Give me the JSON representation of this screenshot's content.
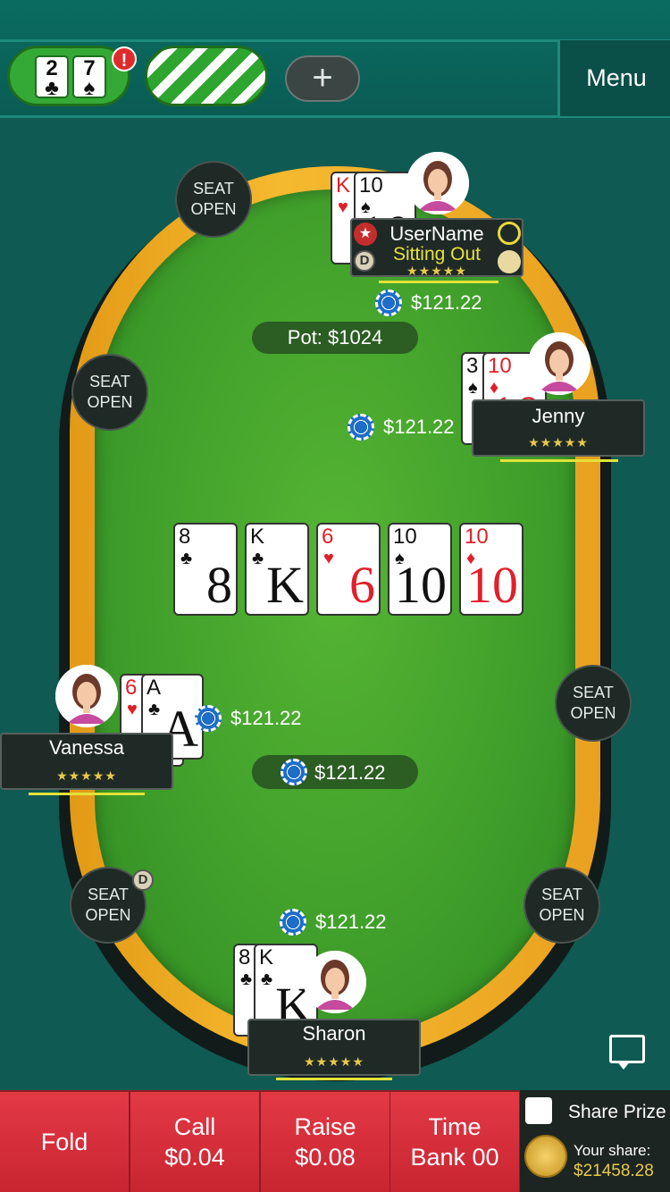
{
  "topbar": {
    "tab1_cards": [
      {
        "rank": "2",
        "suit": "♣"
      },
      {
        "rank": "7",
        "suit": "♠"
      }
    ],
    "notification_badge": "!",
    "add_label": "+",
    "menu_label": "Menu"
  },
  "table": {
    "pot_label": "Pot: $1024",
    "center_bet": "$121.22",
    "community_cards": [
      {
        "rank": "8",
        "suit": "♣",
        "color": "#111111"
      },
      {
        "rank": "K",
        "suit": "♣",
        "color": "#111111"
      },
      {
        "rank": "6",
        "suit": "♥",
        "color": "#e0202a"
      },
      {
        "rank": "10",
        "suit": "♠",
        "color": "#111111"
      },
      {
        "rank": "10",
        "suit": "♦",
        "color": "#e0202a"
      }
    ],
    "seat_open_line1": "SEAT",
    "seat_open_line2": "OPEN",
    "dealer_label": "D"
  },
  "players": {
    "username": {
      "name": "UserName",
      "status": "Sitting Out",
      "stars": "★★★★★",
      "bet": "$121.22",
      "cards": [
        {
          "rank": "K",
          "suit": "♥"
        },
        {
          "rank": "10",
          "suit": "♠"
        }
      ]
    },
    "jenny": {
      "name": "Jenny",
      "stars": "★★★★★",
      "bet": "$121.22",
      "cards": [
        {
          "rank": "3",
          "suit": "♠"
        },
        {
          "rank": "10",
          "suit": "♦"
        }
      ]
    },
    "vanessa": {
      "name": "Vanessa",
      "stars": "★★★★★",
      "bet": "$121.22",
      "cards": [
        {
          "rank": "6",
          "suit": "♥"
        },
        {
          "rank": "A",
          "suit": "♣"
        }
      ]
    },
    "sharon": {
      "name": "Sharon",
      "stars": "★★★★★",
      "bet": "$121.22",
      "cards": [
        {
          "rank": "8",
          "suit": "♣"
        },
        {
          "rank": "K",
          "suit": "♣"
        }
      ]
    }
  },
  "actions": {
    "fold": "Fold",
    "call_label": "Call",
    "call_amount": "$0.04",
    "raise_label": "Raise",
    "raise_amount": "$0.08",
    "timebank_label": "Time",
    "timebank_value": "Bank 00"
  },
  "share": {
    "label": "Share Prize",
    "your_share_label": "Your share:",
    "your_share_value": "$21458.28"
  },
  "colors": {
    "felt": "#4aab2f",
    "rim": "#f0ad25",
    "action_red": "#d92e3a",
    "accent_yellow": "#e9c94a"
  }
}
